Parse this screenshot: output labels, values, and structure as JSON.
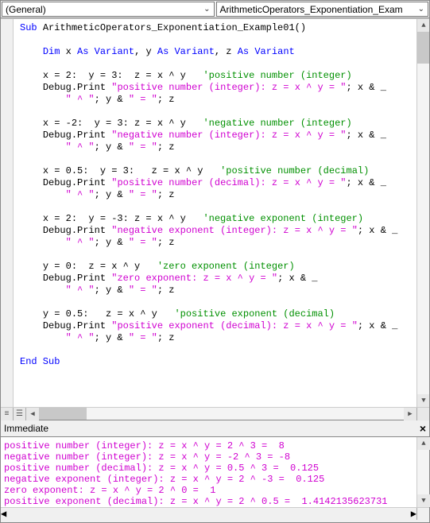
{
  "dropdowns": {
    "object": "(General)",
    "procedure": "ArithmeticOperators_Exponentiation_Exam"
  },
  "code": {
    "sub_kw": "Sub",
    "sub_name": "ArithmeticOperators_Exponentiation_Example01",
    "parens": "()",
    "dim_kw": "Dim",
    "dim_rest_1": " x ",
    "as_kw": "As",
    "variant_kw": "Variant",
    "comma_y": ", y ",
    "comma_z": ", z ",
    "b1_assign": "x = 2:  y = 3:  z = x ^ y   ",
    "b1_cmt": "'positive number (integer)",
    "b1_dbg": "Debug",
    "b1_print": ".Print ",
    "b1_str": "\"positive number (integer): z = x ^ y = \"",
    "b1_tail": "; x & _",
    "b1_cont_str": "\" ^ \"",
    "b1_cont_mid": "; y & ",
    "b1_cont_str2": "\" = \"",
    "b1_cont_end": "; z",
    "b2_assign": "x = -2:  y = 3: z = x ^ y   ",
    "b2_cmt": "'negative number (integer)",
    "b2_str": "\"negative number (integer): z = x ^ y = \"",
    "b3_assign": "x = 0.5:  y = 3:   z = x ^ y   ",
    "b3_cmt": "'positive number (decimal)",
    "b3_str": "\"positive number (decimal): z = x ^ y = \"",
    "b4_assign": "x = 2:  y = -3: z = x ^ y   ",
    "b4_cmt": "'negative exponent (integer)",
    "b4_str": "\"negative exponent (integer): z = x ^ y = \"",
    "b5_assign": "y = 0:  z = x ^ y   ",
    "b5_cmt": "'zero exponent (integer)",
    "b5_str": "\"zero exponent: z = x ^ y = \"",
    "b6_assign": "y = 0.5:   z = x ^ y   ",
    "b6_cmt": "'positive exponent (decimal)",
    "b6_str": "\"positive exponent (decimal): z = x ^ y = \"",
    "end_kw": "End Sub"
  },
  "immediate": {
    "title": "Immediate",
    "l1": "positive number (integer): z = x ^ y = 2 ^ 3 =  8",
    "l2": "negative number (integer): z = x ^ y = -2 ^ 3 = -8",
    "l3": "positive number (decimal): z = x ^ y = 0.5 ^ 3 =  0.125",
    "l4": "negative exponent (integer): z = x ^ y = 2 ^ -3 =  0.125",
    "l5": "zero exponent: z = x ^ y = 2 ^ 0 =  1",
    "l6": "positive exponent (decimal): z = x ^ y = 2 ^ 0.5 =  1.4142135623731"
  }
}
